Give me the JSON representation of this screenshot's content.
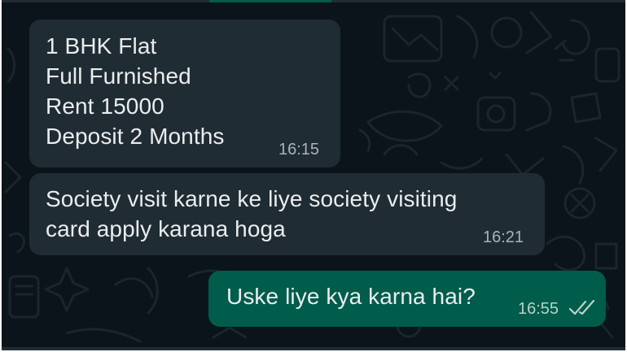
{
  "chat": {
    "messages": [
      {
        "direction": "incoming",
        "lines": [
          "1 BHK Flat",
          "Full Furnished",
          "Rent 15000",
          "Deposit 2 Months"
        ],
        "time": "16:15"
      },
      {
        "direction": "incoming",
        "lines": [
          "Society visit karne ke liye society visiting",
          "card apply karana hoga"
        ],
        "time": "16:21"
      },
      {
        "direction": "outgoing",
        "lines": [
          "Uske liye kya karna hai?"
        ],
        "time": "16:55",
        "status_icon": "double-check-icon"
      }
    ]
  },
  "colors": {
    "background": "#0b141a",
    "incoming_bubble": "#202c33",
    "outgoing_bubble": "#005c4b",
    "text": "#e9edef",
    "timestamp": "#a8b3b8"
  }
}
